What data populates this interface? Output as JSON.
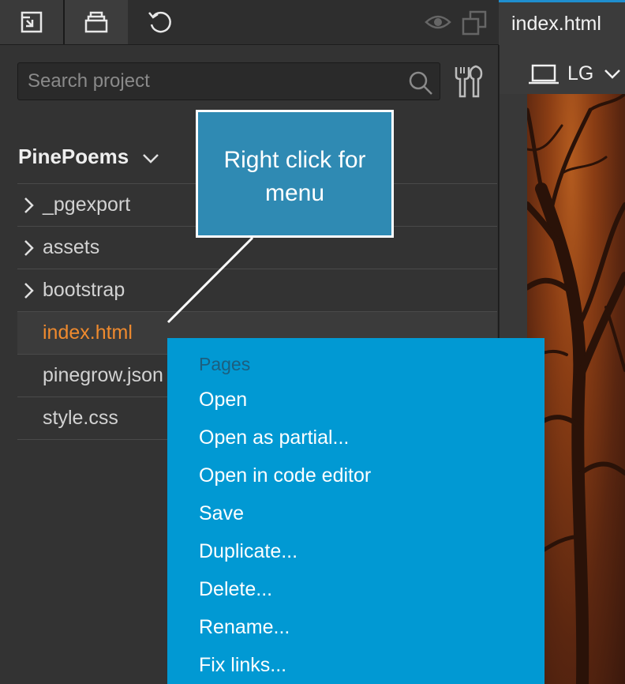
{
  "toolbar": {
    "buttons": [
      {
        "icon": "export-icon"
      },
      {
        "icon": "project-icon"
      },
      {
        "icon": "undo-icon"
      }
    ],
    "right_icons": [
      "eye-icon",
      "windows-icon"
    ]
  },
  "document_tab": {
    "label": "index.html"
  },
  "device": {
    "label": "LG",
    "icon": "laptop-icon"
  },
  "search": {
    "placeholder": "Search project"
  },
  "project": {
    "name": "PinePoems",
    "items": [
      {
        "label": "_pgexport",
        "folder": true
      },
      {
        "label": "assets",
        "folder": true
      },
      {
        "label": "bootstrap",
        "folder": true
      },
      {
        "label": "index.html",
        "folder": false,
        "selected": true
      },
      {
        "label": "pinegrow.json",
        "folder": false
      },
      {
        "label": "style.css",
        "folder": false
      }
    ]
  },
  "callout": {
    "text": "Right click for menu"
  },
  "context_menu": {
    "header": "Pages",
    "items": [
      "Open",
      "Open as partial...",
      "Open in code editor",
      "Save",
      "Duplicate...",
      "Delete...",
      "Rename...",
      "Fix links..."
    ]
  },
  "colors": {
    "accent": "#0199d3",
    "selected_file": "#ef8a2e",
    "callout": "#2f8ab3",
    "tab_indicator": "#1f8ecf"
  }
}
